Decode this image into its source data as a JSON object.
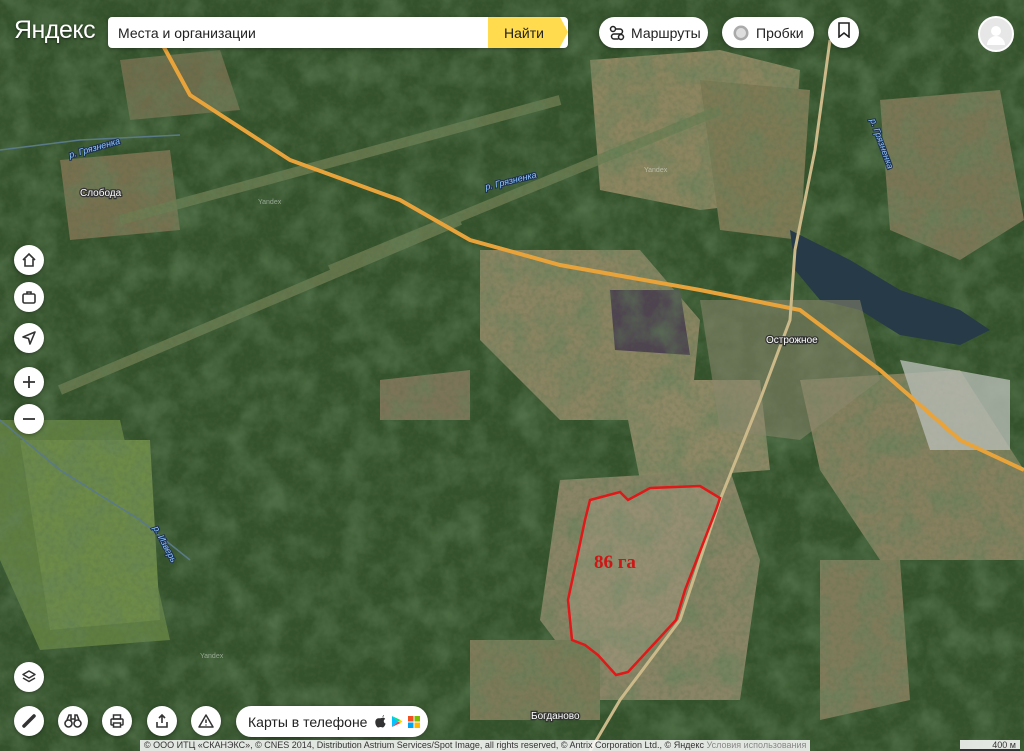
{
  "header": {
    "logo": "Яндекс",
    "search_placeholder": "Места и организации",
    "find_label": "Найти",
    "routes_label": "Маршруты",
    "traffic_label": "Пробки"
  },
  "map": {
    "places": {
      "sloboda": "Слобода",
      "ostrozhnoe": "Острожное",
      "bogdanovo": "Богданово"
    },
    "rivers": {
      "gryaznenka_1": "р. Грязненка",
      "gryaznenka_2": "р. Грязненка",
      "gryaznenka_3": "р. Грязненка",
      "izver": "р. Изверь"
    },
    "area_label": "86 га",
    "watermark": "Yandex"
  },
  "controls": {
    "left": [
      "home-icon",
      "briefcase-icon",
      "navigation-arrow-icon",
      "zoom-in-icon",
      "zoom-out-icon"
    ],
    "bottom": [
      "layers-icon",
      "ruler-icon",
      "binoculars-icon",
      "printer-icon",
      "share-icon",
      "warning-icon"
    ]
  },
  "footer": {
    "apps_label": "Карты в телефоне",
    "copyright": "© ООО ИТЦ «СКАНЭКС», © CNES 2014, Distribution Astrium Services/Spot Image, all rights reserved, © Antrix Corporation Ltd., © Яндекс",
    "terms": "Условия использования",
    "scale": "400 м"
  },
  "colors": {
    "accent": "#ffdb4d",
    "area_outline": "#e01818",
    "road": "#e8a33a"
  }
}
